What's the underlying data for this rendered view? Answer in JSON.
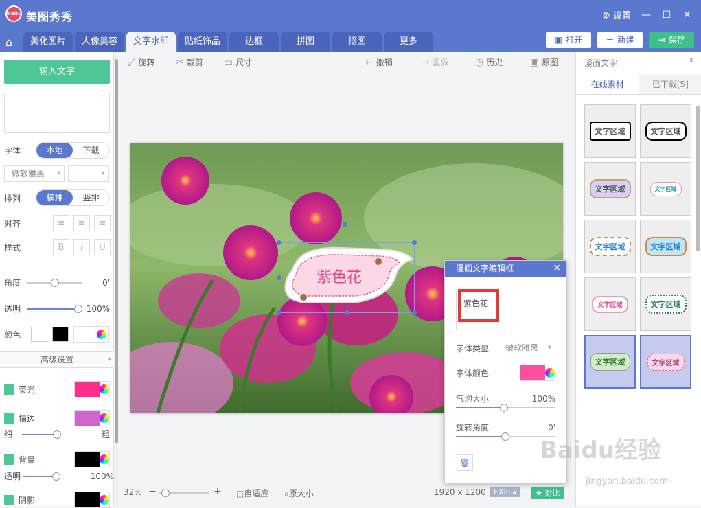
{
  "app": {
    "name": "美图秀秀",
    "logo_text": "meitu",
    "settings_label": "设置"
  },
  "tabs": [
    {
      "label": "美化图片"
    },
    {
      "label": "人像美容"
    },
    {
      "label": "文字水印"
    },
    {
      "label": "贴纸饰品"
    },
    {
      "label": "边框"
    },
    {
      "label": "拼图"
    },
    {
      "label": "抠图"
    },
    {
      "label": "更多"
    }
  ],
  "actions": {
    "open": "打开",
    "new": "新建",
    "save": "保存"
  },
  "left": {
    "input_button": "输入文字",
    "font_label": "字体",
    "font_local": "本地",
    "font_download": "下载",
    "font_name": "微软雅黑",
    "arrange_label": "排列",
    "arrange_h": "横排",
    "arrange_v": "竖排",
    "align_label": "对齐",
    "style_label": "样式",
    "style_b": "B",
    "style_i": "I",
    "style_u": "U",
    "angle_label": "角度",
    "angle_value": "0'",
    "opacity_label": "透明",
    "opacity_value": "100%",
    "color_label": "颜色",
    "advanced": "高级设置",
    "glow": "荧光",
    "stroke": "描边",
    "thin": "细",
    "thick": "粗",
    "background": "背景",
    "bg_opacity": "透明",
    "bg_opacity_value": "100%",
    "shadow": "阴影",
    "colors": {
      "glow": "#ff2e88",
      "stroke": "#cc66cc",
      "background": "#000000",
      "shadow": "#000000",
      "text": "#000000"
    }
  },
  "toolbar": {
    "rotate": "旋转",
    "crop": "裁剪",
    "size": "尺寸",
    "undo": "撤销",
    "redo": "重做",
    "history": "历史",
    "original": "原图"
  },
  "canvas": {
    "bubble_text": "紫色花"
  },
  "bottom": {
    "zoom": "32%",
    "fit": "自适应",
    "actual": "原大小",
    "dimensions": "1920 x 1200",
    "exif": "EXIF",
    "compare": "对比"
  },
  "right": {
    "category": "漫画文字",
    "tab_online": "在线素材",
    "tab_downloaded": "已下载[5]",
    "items": [
      {
        "text": "文字区域"
      },
      {
        "text": "文字区域"
      },
      {
        "text": "文字区域"
      },
      {
        "text": "文字区域"
      },
      {
        "text": "文字区域"
      },
      {
        "text": "文字区域"
      },
      {
        "text": "文字区域"
      },
      {
        "text": "文字区域"
      },
      {
        "text": "文字区域"
      },
      {
        "text": "文字区域"
      }
    ]
  },
  "dialog": {
    "title": "漫画文字编辑框",
    "text": "紫色花",
    "font_type_label": "字体类型",
    "font_type_value": "微软雅黑",
    "font_color_label": "字体颜色",
    "font_color": "#ff4fa0",
    "bubble_size_label": "气泡大小",
    "bubble_size_value": "100%",
    "rotate_label": "旋转角度",
    "rotate_value": "0'"
  },
  "watermark": {
    "text": "Baidu经验",
    "url": "jingyan.baidu.com"
  }
}
